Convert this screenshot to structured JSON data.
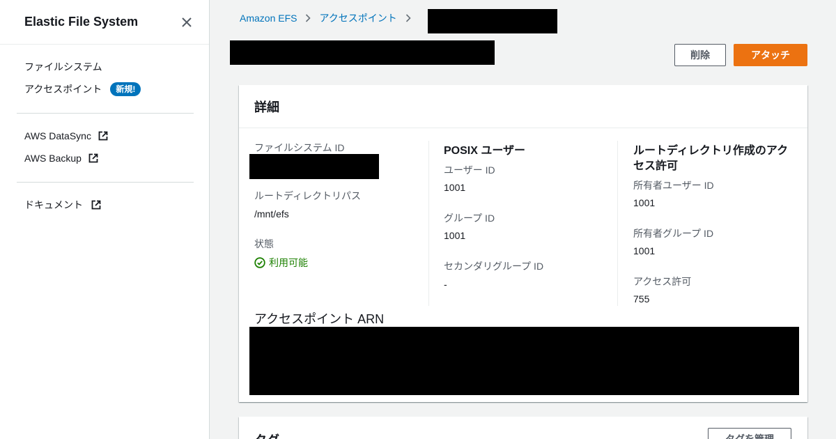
{
  "sidebar": {
    "title": "Elastic File System",
    "close_icon": "close-icon",
    "items": [
      {
        "label": "ファイルシステム"
      },
      {
        "label": "アクセスポイント",
        "badge": "新規!"
      }
    ],
    "external_links": [
      {
        "label": "AWS DataSync",
        "icon": "external-link-icon"
      },
      {
        "label": "AWS Backup",
        "icon": "external-link-icon"
      }
    ],
    "docs": {
      "label": "ドキュメント",
      "icon": "external-link-icon"
    }
  },
  "breadcrumb": {
    "items": [
      "Amazon EFS",
      "アクセスポイント"
    ]
  },
  "header": {
    "delete_label": "削除",
    "attach_label": "アタッチ"
  },
  "details": {
    "title": "詳細",
    "filesystem_id_label": "ファイルシステム ID",
    "root_path_label": "ルートディレクトリパス",
    "root_path_value": "/mnt/efs",
    "state_label": "状態",
    "state_value": "利用可能",
    "posix": {
      "title": "POSIX ユーザー",
      "user_id_label": "ユーザー ID",
      "user_id_value": "1001",
      "group_id_label": "グループ ID",
      "group_id_value": "1001",
      "secondary_group_label": "セカンダリグループ ID",
      "secondary_group_value": "-"
    },
    "root_permissions": {
      "title": "ルートディレクトリ作成のアクセス許可",
      "owner_user_label": "所有者ユーザー ID",
      "owner_user_value": "1001",
      "owner_group_label": "所有者グループ ID",
      "owner_group_value": "1001",
      "permissions_label": "アクセス許可",
      "permissions_value": "755"
    },
    "arn_label": "アクセスポイント ARN"
  },
  "tags": {
    "title": "タグ",
    "manage_label": "タグを管理"
  },
  "colors": {
    "link": "#0073bb",
    "primary_button": "#ec7211",
    "success": "#1d8102",
    "badge": "#0073bb"
  }
}
